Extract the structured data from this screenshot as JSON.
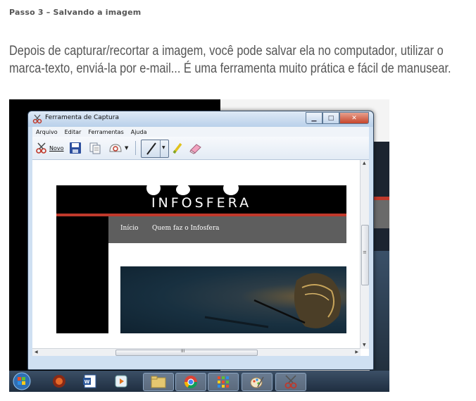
{
  "article": {
    "step_title": "Passo 3 – Salvando a imagem",
    "description_lines": [
      "Depois de capturar/recortar a imagem, você pode salvar ela no computador, utilizar o",
      "marca-texto, enviá-la por e-mail... É uma ferramenta muito prática e fácil de manusear."
    ]
  },
  "window": {
    "title": "Ferramenta de Captura",
    "controls": {
      "minimize": "▁",
      "maximize": "□",
      "close": "✕"
    }
  },
  "menu": [
    "Arquivo",
    "Editar",
    "Ferramentas",
    "Ajuda"
  ],
  "toolbar": {
    "new_label": "Novo"
  },
  "captured_site": {
    "logo": "INFOSFERA",
    "nav": [
      "Início",
      "Quem faz o Infosfera"
    ]
  },
  "scrollbar": {
    "grip": "III",
    "vgrip": "≡"
  },
  "colors": {
    "site_red": "#c0392b",
    "nav_gray": "#5e5e5e"
  }
}
